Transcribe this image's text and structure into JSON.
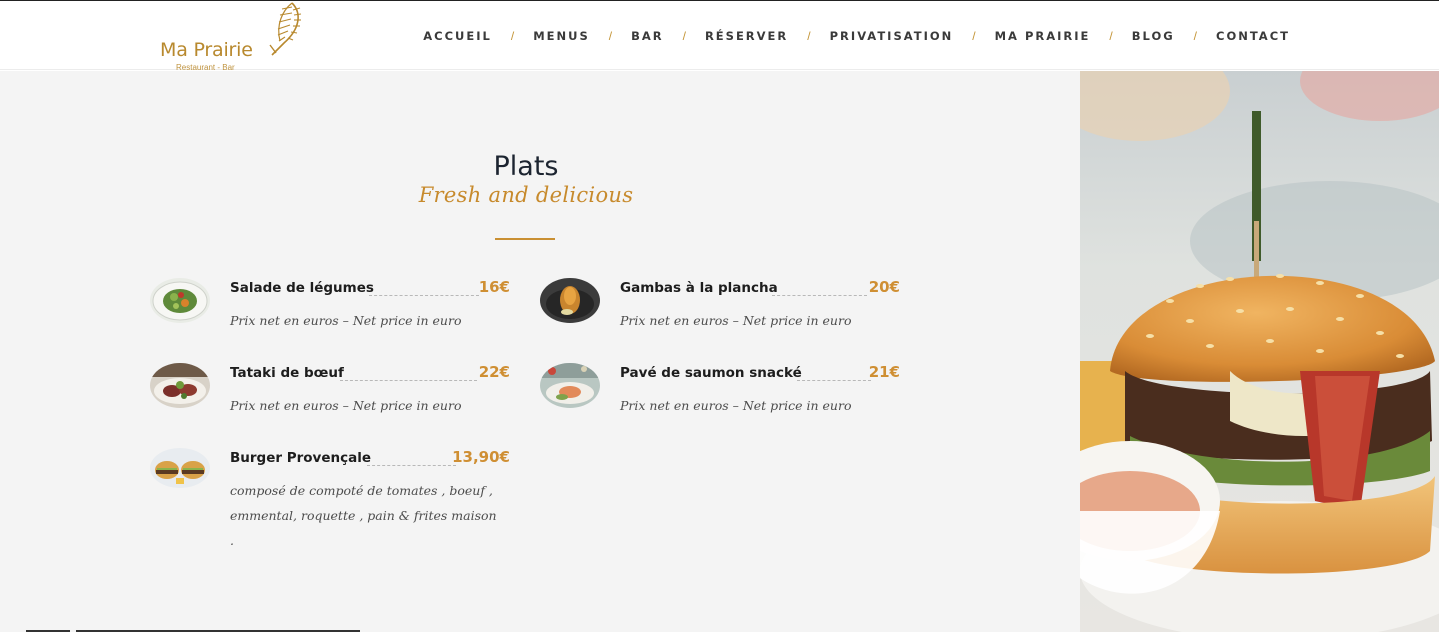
{
  "brand": {
    "name": "Ma Prairie",
    "tagline": "Restaurant - Bar",
    "color": "#b8892e"
  },
  "nav": {
    "items": [
      {
        "label": "ACCUEIL"
      },
      {
        "label": "MENUS"
      },
      {
        "label": "BAR"
      },
      {
        "label": "RÉSERVER"
      },
      {
        "label": "PRIVATISATION"
      },
      {
        "label": "MA PRAIRIE"
      },
      {
        "label": "BLOG"
      },
      {
        "label": "CONTACT"
      }
    ],
    "separator": "/"
  },
  "section": {
    "title": "Plats",
    "subtitle": "Fresh and delicious",
    "accent": "#c98f32"
  },
  "dishes": [
    {
      "name": "Salade de légumes",
      "price": "16€",
      "description": "Prix net en euros – Net price in euro",
      "icon": "salad-photo"
    },
    {
      "name": "Gambas à la plancha",
      "price": "20€",
      "description": "Prix net en euros – Net price in euro",
      "icon": "gambas-photo"
    },
    {
      "name": "Tataki de bœuf",
      "price": "22€",
      "description": "Prix net en euros – Net price in euro",
      "icon": "beef-tataki-photo"
    },
    {
      "name": "Pavé de saumon snacké",
      "price": "21€",
      "description": "Prix net en euros – Net price in euro",
      "icon": "salmon-photo"
    },
    {
      "name": "Burger Provençale",
      "price": "13,90€",
      "description": "composé de compoté de tomates , boeuf , emmental, roquette , pain & frites maison .",
      "icon": "burger-photo"
    }
  ],
  "hero": {
    "icon": "burger-hero-photo"
  }
}
